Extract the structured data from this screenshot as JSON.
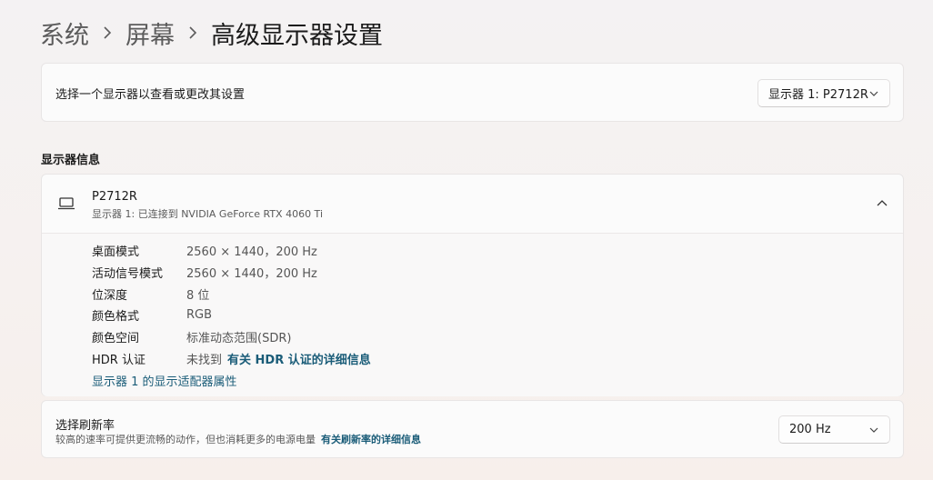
{
  "breadcrumb": {
    "items": [
      "系统",
      "屏幕",
      "高级显示器设置"
    ]
  },
  "select_display": {
    "label": "选择一个显示器以查看或更改其设置",
    "selected": "显示器 1: P2712R"
  },
  "display_info": {
    "section_title": "显示器信息",
    "monitor_name": "P2712R",
    "monitor_subtitle": "显示器 1: 已连接到 NVIDIA GeForce RTX 4060 Ti",
    "rows": [
      {
        "label": "桌面模式",
        "value": "2560 × 1440，200 Hz"
      },
      {
        "label": "活动信号模式",
        "value": "2560 × 1440，200 Hz"
      },
      {
        "label": "位深度",
        "value": "8 位"
      },
      {
        "label": "颜色格式",
        "value": "RGB"
      },
      {
        "label": "颜色空间",
        "value": "标准动态范围(SDR)"
      },
      {
        "label": "HDR 认证",
        "value": "未找到",
        "link": "有关 HDR 认证的详细信息"
      }
    ],
    "adapter_link": "显示器 1 的显示适配器属性"
  },
  "refresh_rate": {
    "title": "选择刷新率",
    "description": "较高的速率可提供更流畅的动作，但也消耗更多的电源电量",
    "link": "有关刷新率的详细信息",
    "selected": "200 Hz"
  },
  "colors": {
    "link": "#1a5c78",
    "card_bg": "#fbfbfb",
    "text": "#1b1b1b",
    "secondary_text": "#5a5a5a"
  },
  "icons": {
    "breadcrumb_separator": "chevron-right-icon",
    "dropdown": "chevron-down-icon",
    "monitor": "laptop-icon",
    "collapse": "chevron-up-icon"
  }
}
